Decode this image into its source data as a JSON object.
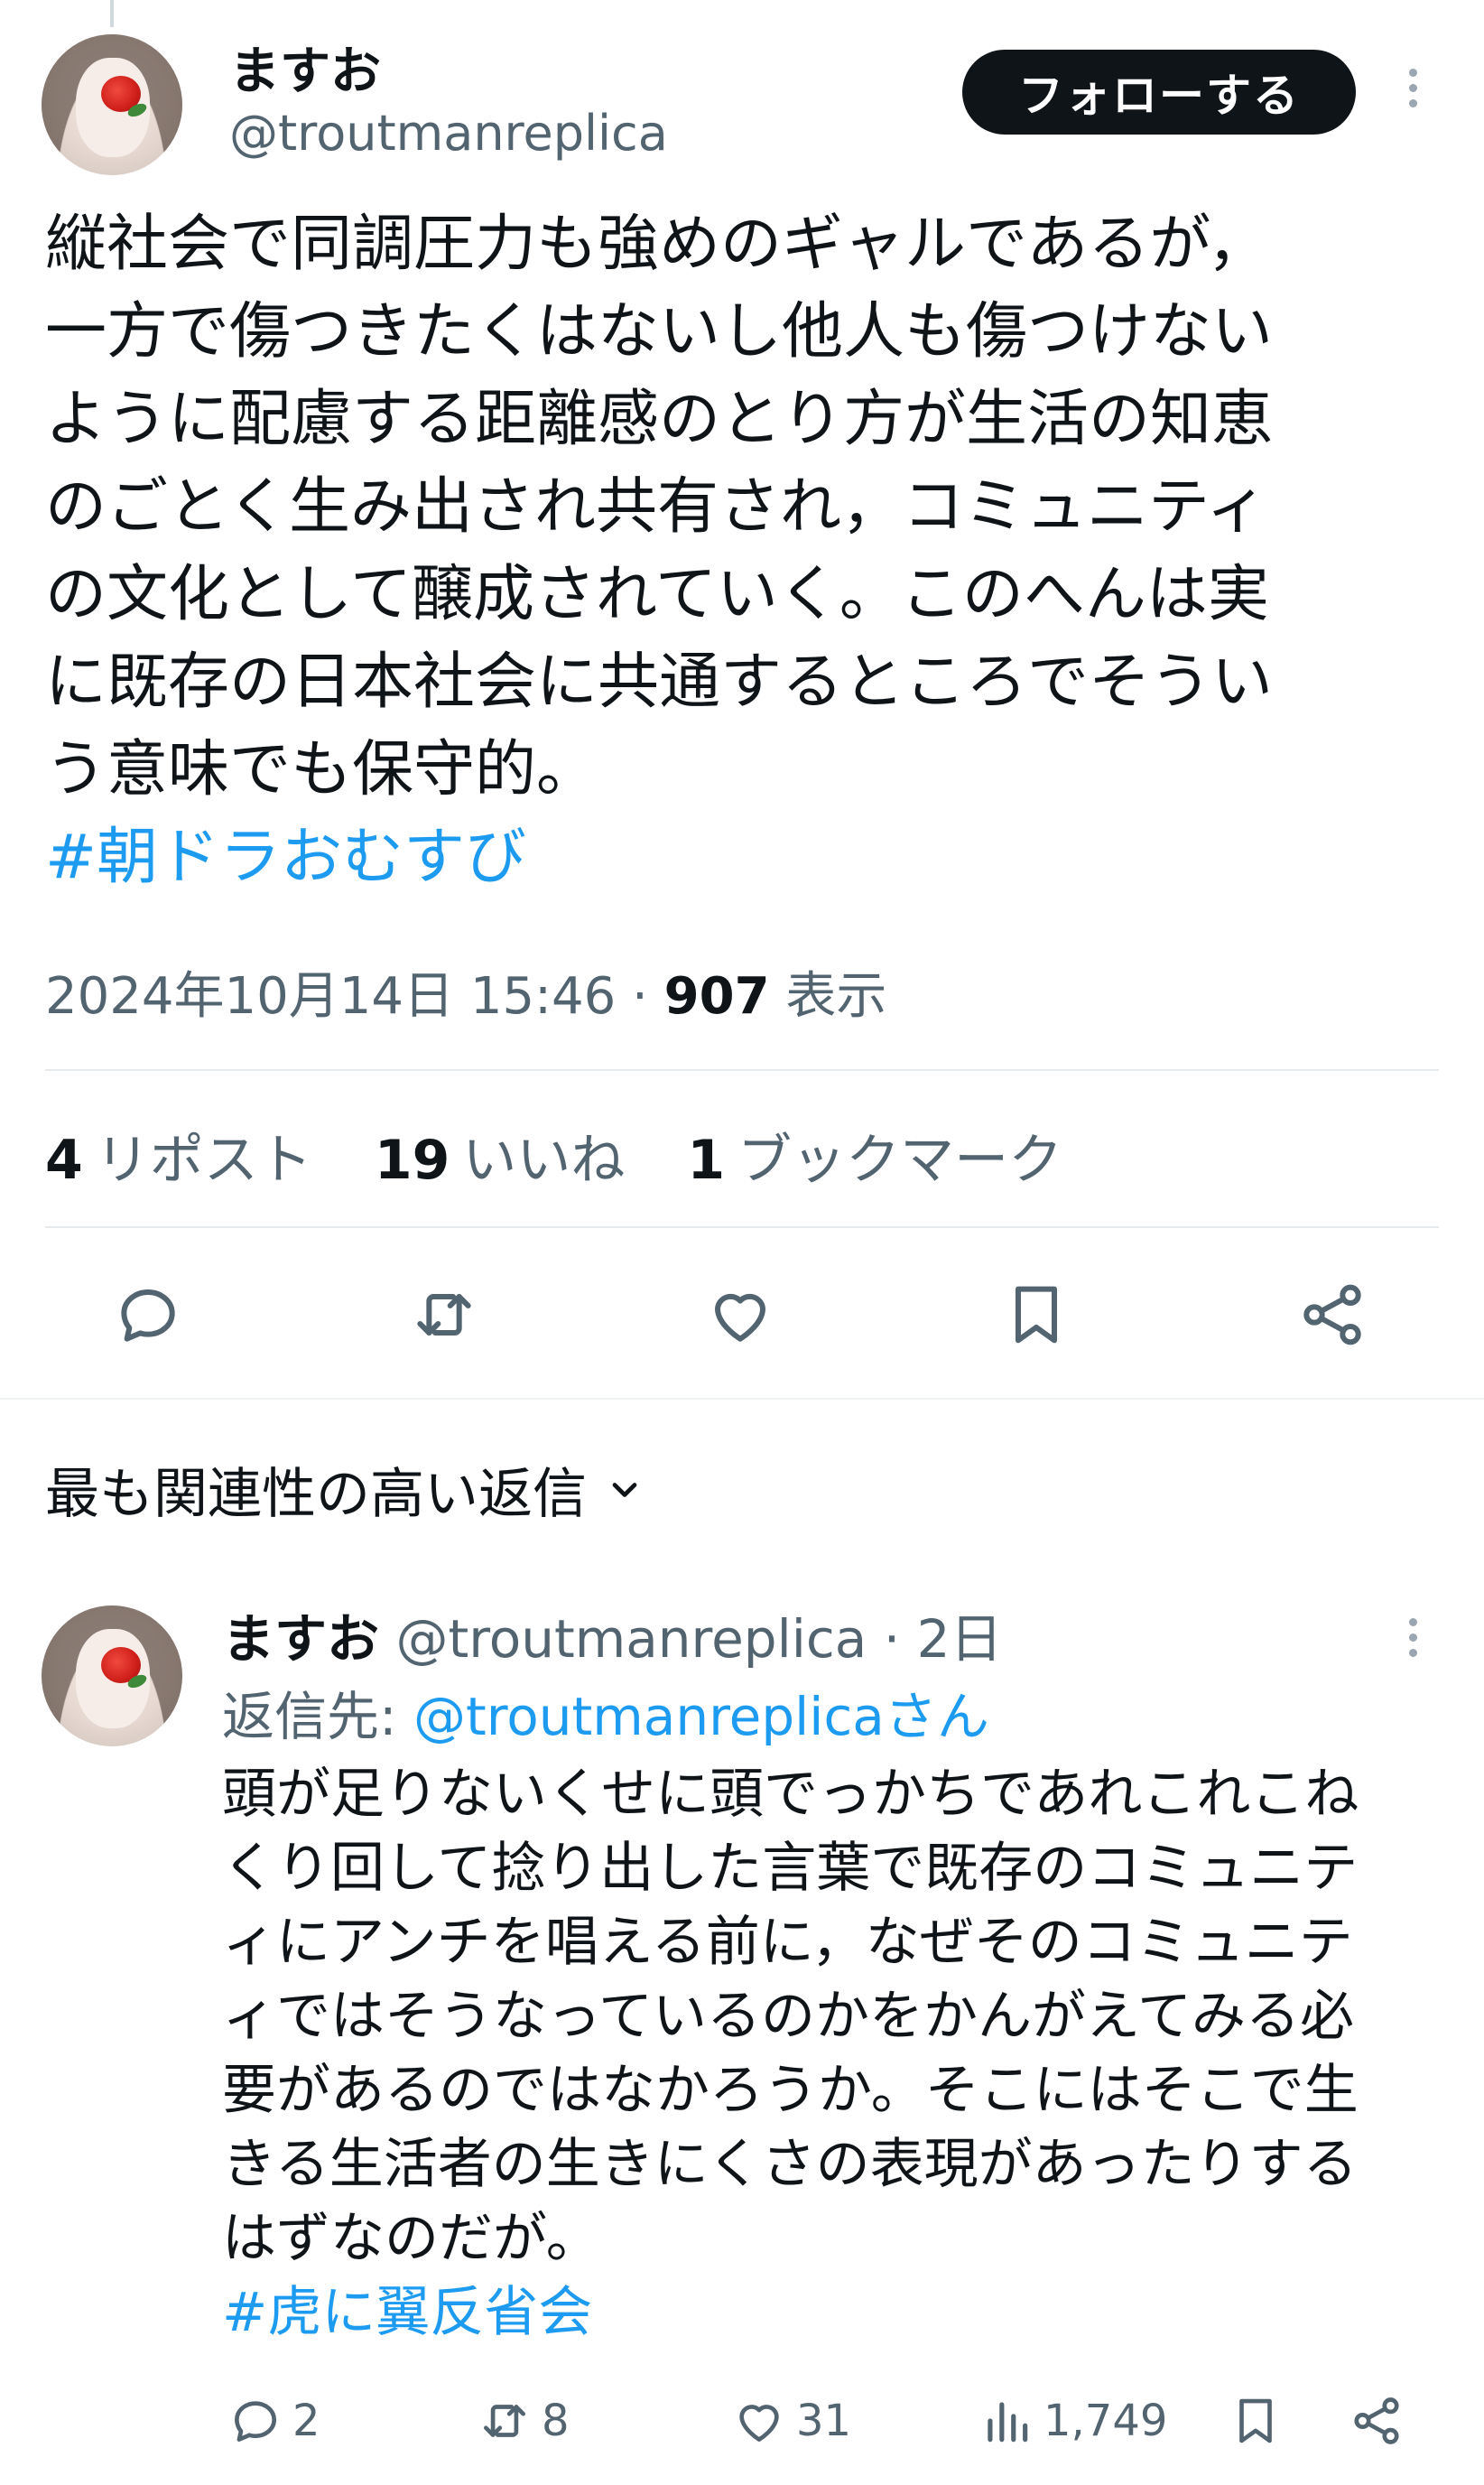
{
  "tweet": {
    "author_name": "ますお",
    "author_handle": "@troutmanreplica",
    "follow_label": "フォローする",
    "text_lines": [
      "縦社会で同調圧力も強めのギャルであるが，",
      "一方で傷つきたくはないし他人も傷つけない",
      "ように配慮する距離感のとり方が生活の知恵",
      "のごとく生み出され共有され，コミュニティ",
      "の文化として醸成されていく。このへんは実",
      "に既存の日本社会に共通するところでそうい",
      "う意味でも保守的。"
    ],
    "hashtag": "#朝ドラおむすび",
    "timestamp": "2024年10月14日 15:46",
    "separator": "·",
    "views_count": "907",
    "views_label": "表示",
    "reposts_count": "4",
    "reposts_label": "リポスト",
    "likes_count": "19",
    "likes_label": "いいね",
    "bookmarks_count": "1",
    "bookmarks_label": "ブックマーク"
  },
  "replies_sort": {
    "label": "最も関連性の高い返信"
  },
  "reply": {
    "author_name": "ますお",
    "author_handle": "@troutmanreplica",
    "time_sep": "·",
    "time_ago": "2日",
    "reply_to_prefix": "返信先: ",
    "reply_to_handle": "@troutmanreplicaさん",
    "text_lines": [
      "頭が足りないくせに頭でっかちであれこれこね",
      "くり回して捻り出した言葉で既存のコミュニテ",
      "ィにアンチを唱える前に，なぜそのコミュニテ",
      "ィではそうなっているのかをかんがえてみる必",
      "要があるのではなかろうか。そこにはそこで生",
      "きる生活者の生きにくさの表現があったりする",
      "はずなのだが。"
    ],
    "hashtag": "#虎に翼反省会",
    "stats": {
      "replies": "2",
      "reposts": "8",
      "likes": "31",
      "views": "1,749"
    }
  },
  "icons": [
    "reply-icon",
    "repost-icon",
    "like-icon",
    "bookmark-icon",
    "share-icon",
    "views-icon",
    "more-icon",
    "chevron-down-icon"
  ],
  "colors": {
    "accent": "#1d9bf0",
    "text": "#0f1419",
    "muted": "#536471",
    "button": "#0f1419"
  }
}
